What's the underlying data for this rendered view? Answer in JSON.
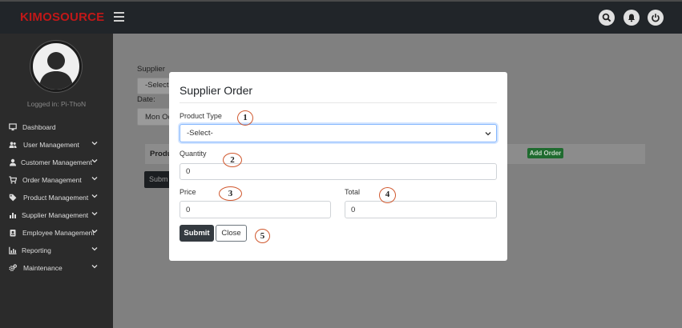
{
  "app": {
    "brand": "KIMOSOURCE"
  },
  "topbar": {
    "icons": [
      "search-icon",
      "bell-icon",
      "power-icon"
    ]
  },
  "sidebar": {
    "logged_in": "Logged in: Pi-ThoN",
    "items": [
      {
        "label": "Dashboard",
        "icon": "monitor-icon",
        "has_chevron": false
      },
      {
        "label": "User Management",
        "icon": "users-icon",
        "has_chevron": true
      },
      {
        "label": "Customer Management",
        "icon": "user-icon",
        "has_chevron": true
      },
      {
        "label": "Order Management",
        "icon": "cart-icon",
        "has_chevron": true
      },
      {
        "label": "Product Management",
        "icon": "tag-icon",
        "has_chevron": true
      },
      {
        "label": "Supplier Management",
        "icon": "chart-icon",
        "has_chevron": true
      },
      {
        "label": "Employee Management",
        "icon": "id-badge-icon",
        "has_chevron": true
      },
      {
        "label": "Reporting",
        "icon": "bar-chart-icon",
        "has_chevron": true
      },
      {
        "label": "Maintenance",
        "icon": "cogs-icon",
        "has_chevron": true
      }
    ]
  },
  "background": {
    "supplier_label": "Supplier",
    "supplier_select": "-Select-",
    "date_label": "Date:",
    "date_value": "Mon Oc",
    "table_header": "Produ",
    "add_order": "Add Order",
    "submit": "Subm"
  },
  "modal": {
    "title": "Supplier Order",
    "product_type_label": "Product Type",
    "product_type_value": "-Select-",
    "quantity_label": "Quantity",
    "quantity_value": "0",
    "price_label": "Price",
    "price_value": "0",
    "total_label": "Total",
    "total_value": "0",
    "submit_label": "Submit",
    "close_label": "Close"
  },
  "annotations": [
    "1",
    "2",
    "3",
    "4",
    "5"
  ],
  "colors": {
    "brand": "#c01818",
    "topbar": "#212529",
    "sidebar": "#2b2b2b",
    "focus": "#86b7fe",
    "marker": "#d0582e",
    "add_order": "#1f6b2f"
  }
}
